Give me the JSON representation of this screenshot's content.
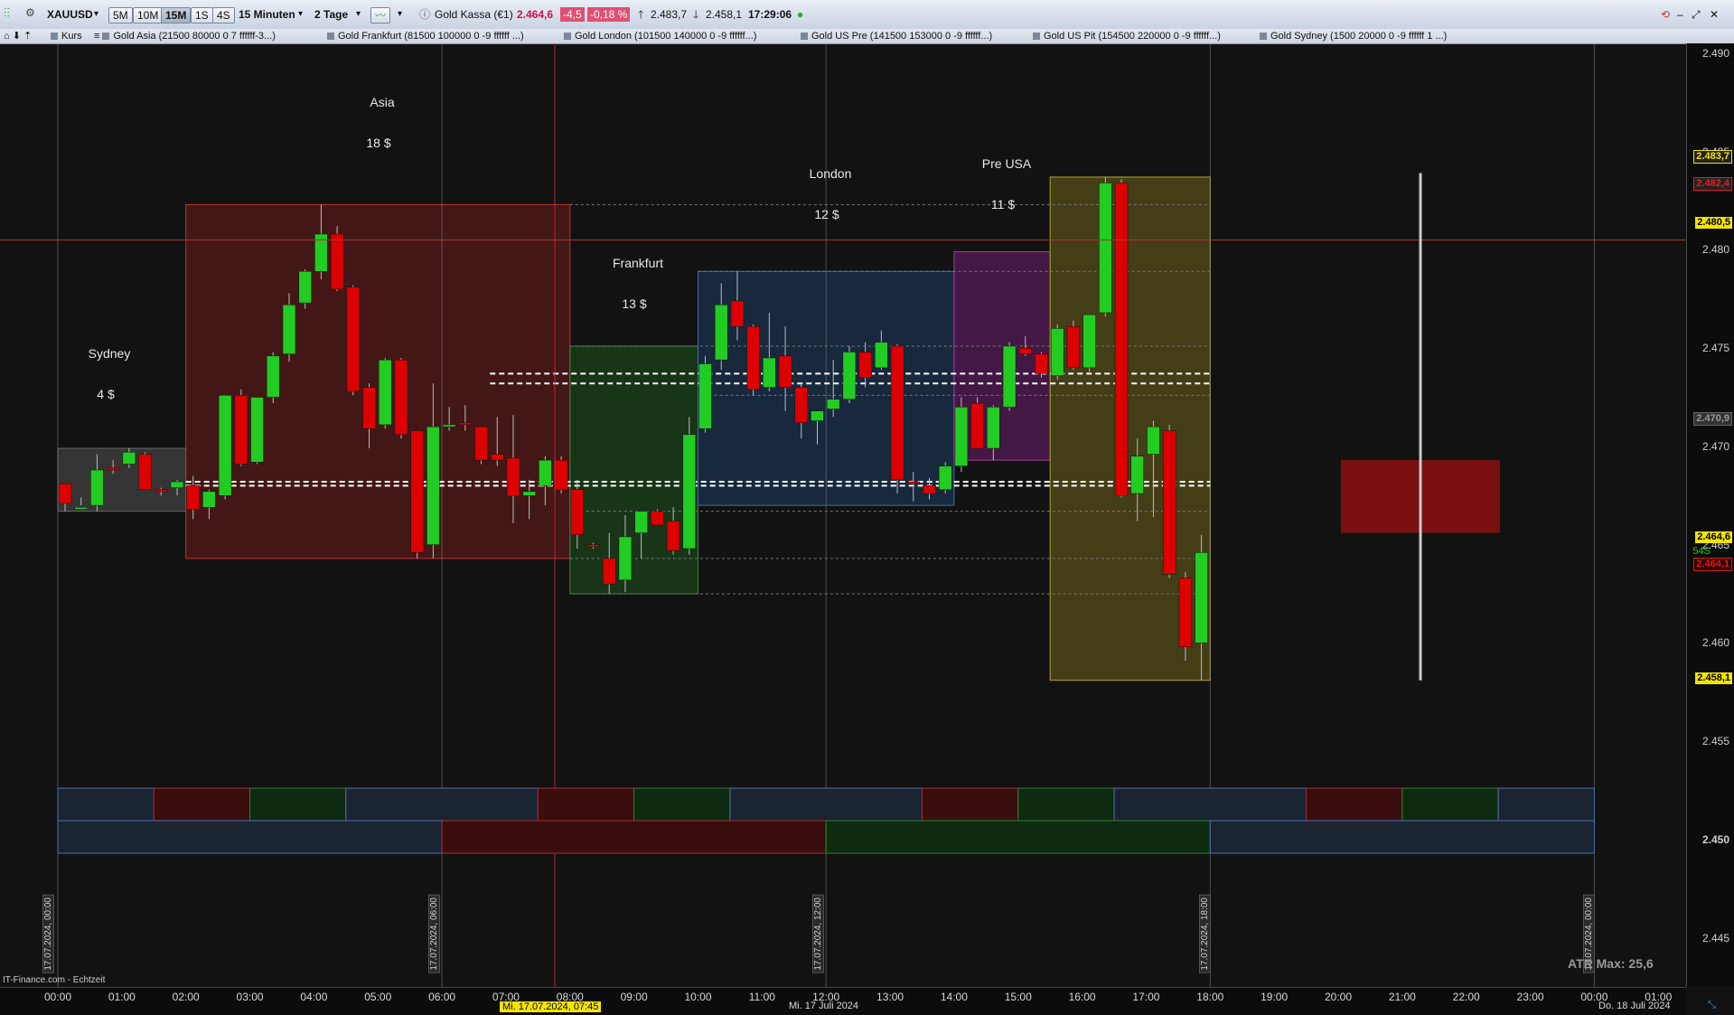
{
  "toolbar": {
    "symbol": "XAUUSD",
    "timeframes": [
      "5M",
      "10M",
      "15M",
      "1S",
      "4S"
    ],
    "active_timeframe": "15M",
    "interval": "15 Minuten",
    "range": "2 Tage",
    "instrument": "Gold Kassa (€1)",
    "last_price": "2.464,6",
    "change": "-4,5",
    "change_pct": "-0,18 %",
    "high": "2.483,7",
    "low": "2.458,1",
    "time": "17:29:06"
  },
  "tabs": {
    "kurs": "Kurs",
    "items": [
      "Gold Asia (21500 80000 0 7 ffffff-3...)",
      "Gold Frankfurt (81500 100000 0 -9 ffffff ...)",
      "Gold London (101500 140000 0 -9 ffffff...)",
      "Gold US Pre (141500 153000 0 -9 ffffff...)",
      "Gold US Pit (154500 220000 0 -9 ffffff...)",
      "Gold Sydney (1500 20000 0 -9 ffffff 1 ...)"
    ]
  },
  "sessions": [
    {
      "name": "Sydney",
      "range": "4 $",
      "color": "#3a3a3a"
    },
    {
      "name": "Asia",
      "range": "18 $",
      "color": "#5a1a1a"
    },
    {
      "name": "Frankfurt",
      "range": "13 $",
      "color": "#1c3f1c"
    },
    {
      "name": "London",
      "range": "12 $",
      "color": "#1c3048"
    },
    {
      "name": "Pre USA",
      "range": "11 $",
      "color": "#5a1f5a"
    }
  ],
  "footer": {
    "source": "IT-Finance.com - Echtzeit",
    "atr": "ATR Max: 25,6",
    "cursor_time": "Mi. 17.07.2024, 07:45",
    "date_center": "Mi. 17 Juli 2024",
    "date_right": "Do. 18 Juli 2024",
    "vertical_dates": [
      "17.07.2024, 00:00",
      "17.07.2024, 06:00",
      "17.07.2024, 12:00",
      "17.07.2024, 18:00",
      "18.07.2024, 00:00"
    ]
  },
  "price_tags": {
    "high": "2.483,7",
    "prev": "2.482,4",
    "cursor": "2.480,5",
    "level": "2.470,9",
    "last": "2.464,6",
    "countdown": "54S",
    "bid": "2.464,1",
    "low": "2.458,1"
  },
  "colors": {
    "up": "#22cc22",
    "down": "#dd0000",
    "bg": "#121212",
    "cursor": "#b03030"
  },
  "chart_data": {
    "type": "candlestick",
    "ylim": [
      2442.5,
      2490.5
    ],
    "y_ticks": [
      "2.490",
      "2.485",
      "2.480",
      "2.475",
      "2.470",
      "2.465",
      "2.460",
      "2.455",
      "2.450",
      "2.445"
    ],
    "x_ticks": [
      "00:00",
      "01:00",
      "02:00",
      "03:00",
      "04:00",
      "05:00",
      "06:00",
      "07:00",
      "08:00",
      "09:00",
      "10:00",
      "11:00",
      "12:00",
      "13:00",
      "14:00",
      "15:00",
      "16:00",
      "17:00",
      "18:00",
      "19:00",
      "20:00",
      "21:00",
      "22:00",
      "23:00",
      "00:00",
      "01:00"
    ],
    "candles": [
      [
        0.0,
        2468.1,
        2467.7,
        2466.7,
        2467.1
      ],
      [
        0.25,
        2466.8,
        2467.4,
        2467.0,
        2466.9
      ],
      [
        0.5,
        2467.0,
        2469.6,
        2466.7,
        2468.8
      ],
      [
        0.75,
        2468.9,
        2469.3,
        2468.6,
        2468.8
      ],
      [
        1.0,
        2469.1,
        2469.9,
        2468.9,
        2469.7
      ],
      [
        1.25,
        2469.6,
        2469.7,
        2467.8,
        2467.8
      ],
      [
        1.5,
        2467.8,
        2467.9,
        2467.5,
        2467.7
      ],
      [
        1.75,
        2467.9,
        2468.3,
        2467.5,
        2468.2
      ],
      [
        2.0,
        2468.0,
        2468.5,
        2466.3,
        2466.8
      ],
      [
        2.25,
        2466.9,
        2467.8,
        2466.3,
        2467.7
      ],
      [
        2.5,
        2467.5,
        2472.6,
        2467.3,
        2472.6
      ],
      [
        2.75,
        2472.6,
        2472.9,
        2469.0,
        2469.1
      ],
      [
        3.0,
        2469.2,
        2472.5,
        2469.1,
        2472.5
      ],
      [
        3.25,
        2472.5,
        2474.8,
        2472.2,
        2474.6
      ],
      [
        3.5,
        2474.7,
        2477.8,
        2474.3,
        2477.2
      ],
      [
        3.75,
        2477.3,
        2479.0,
        2477.0,
        2478.9
      ],
      [
        4.0,
        2478.9,
        2482.3,
        2478.5,
        2480.8
      ],
      [
        4.25,
        2480.8,
        2481.2,
        2477.9,
        2478.0
      ],
      [
        4.5,
        2478.1,
        2478.2,
        2472.6,
        2472.8
      ],
      [
        4.75,
        2473.0,
        2473.2,
        2469.9,
        2470.9
      ],
      [
        5.0,
        2471.1,
        2474.5,
        2470.9,
        2474.4
      ],
      [
        5.25,
        2474.4,
        2474.5,
        2470.4,
        2470.6
      ],
      [
        5.5,
        2470.8,
        2470.8,
        2464.3,
        2464.6
      ],
      [
        5.75,
        2465.0,
        2473.2,
        2464.3,
        2471.0
      ],
      [
        6.0,
        2471.0,
        2472.0,
        2470.8,
        2471.1
      ],
      [
        6.25,
        2471.2,
        2472.1,
        2470.8,
        2471.1
      ],
      [
        6.5,
        2471.0,
        2471.0,
        2469.1,
        2469.3
      ],
      [
        6.75,
        2469.6,
        2471.5,
        2469.0,
        2469.3
      ],
      [
        7.0,
        2469.4,
        2471.6,
        2466.1,
        2467.5
      ],
      [
        7.25,
        2467.5,
        2468.3,
        2466.3,
        2467.7
      ],
      [
        7.5,
        2468.0,
        2469.5,
        2467.0,
        2469.3
      ],
      [
        7.75,
        2469.3,
        2469.5,
        2467.6,
        2467.8
      ],
      [
        8.0,
        2467.8,
        2468.3,
        2464.8,
        2465.5
      ],
      [
        8.25,
        2465.0,
        2465.1,
        2464.8,
        2464.9
      ],
      [
        8.5,
        2464.3,
        2465.6,
        2462.5,
        2463.0
      ],
      [
        8.75,
        2463.2,
        2466.5,
        2462.6,
        2465.4
      ],
      [
        9.0,
        2465.6,
        2466.7,
        2464.3,
        2466.7
      ],
      [
        9.25,
        2466.7,
        2466.8,
        2466.3,
        2466.0
      ],
      [
        9.5,
        2466.2,
        2466.9,
        2464.5,
        2464.7
      ],
      [
        9.75,
        2464.8,
        2471.5,
        2464.5,
        2470.6
      ],
      [
        10.0,
        2470.9,
        2474.6,
        2470.7,
        2474.2
      ],
      [
        10.25,
        2474.4,
        2478.3,
        2473.9,
        2477.2
      ],
      [
        10.5,
        2477.4,
        2478.9,
        2475.4,
        2476.1
      ],
      [
        10.75,
        2476.1,
        2476.2,
        2472.6,
        2472.9
      ],
      [
        11.0,
        2473.0,
        2476.8,
        2472.8,
        2474.5
      ],
      [
        11.25,
        2474.6,
        2476.1,
        2471.8,
        2473.0
      ],
      [
        11.5,
        2473.0,
        2473.2,
        2470.4,
        2471.2
      ],
      [
        11.75,
        2471.3,
        2471.7,
        2470.1,
        2471.8
      ],
      [
        12.0,
        2471.9,
        2474.4,
        2471.5,
        2472.4
      ],
      [
        12.25,
        2472.4,
        2475.1,
        2472.2,
        2474.8
      ],
      [
        12.5,
        2474.8,
        2475.3,
        2473.0,
        2473.5
      ],
      [
        12.75,
        2474.0,
        2475.9,
        2473.9,
        2475.3
      ],
      [
        13.0,
        2475.1,
        2475.2,
        2467.6,
        2468.3
      ],
      [
        13.25,
        2468.2,
        2468.7,
        2467.2,
        2468.1
      ],
      [
        13.5,
        2468.0,
        2468.4,
        2467.3,
        2467.6
      ],
      [
        13.75,
        2467.8,
        2469.2,
        2467.6,
        2469.0
      ],
      [
        14.0,
        2469.0,
        2472.5,
        2468.7,
        2472.0
      ],
      [
        14.25,
        2472.2,
        2472.5,
        2469.9,
        2469.9
      ],
      [
        14.5,
        2469.9,
        2472.1,
        2469.3,
        2472.0
      ],
      [
        14.75,
        2472.0,
        2475.3,
        2471.8,
        2475.1
      ],
      [
        15.0,
        2475.0,
        2475.6,
        2474.6,
        2474.7
      ],
      [
        15.25,
        2474.7,
        2474.8,
        2473.5,
        2473.7
      ],
      [
        15.5,
        2473.6,
        2476.2,
        2473.4,
        2476.0
      ],
      [
        15.75,
        2476.1,
        2476.4,
        2473.9,
        2474.0
      ],
      [
        16.0,
        2474.0,
        2476.7,
        2473.8,
        2476.7
      ],
      [
        16.25,
        2476.8,
        2483.7,
        2476.6,
        2483.4
      ],
      [
        16.5,
        2483.4,
        2483.6,
        2467.4,
        2467.5
      ],
      [
        16.75,
        2467.6,
        2470.4,
        2466.2,
        2469.5
      ],
      [
        17.0,
        2469.6,
        2471.3,
        2466.4,
        2471.0
      ],
      [
        17.25,
        2470.8,
        2471.1,
        2463.3,
        2463.5
      ],
      [
        17.5,
        2463.3,
        2463.6,
        2459.1,
        2459.8
      ],
      [
        17.75,
        2460.0,
        2465.5,
        2458.1,
        2464.6
      ]
    ]
  }
}
